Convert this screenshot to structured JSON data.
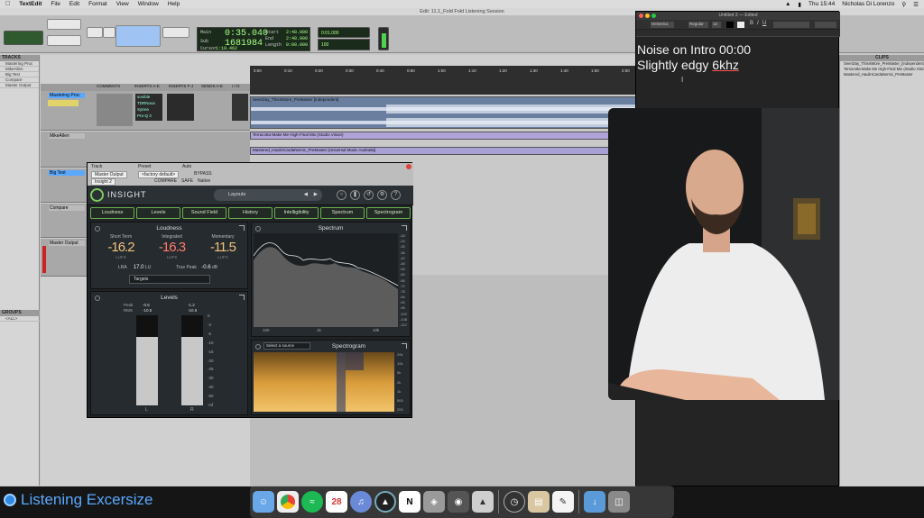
{
  "menubar": {
    "app": "TextEdit",
    "items": [
      "File",
      "Edit",
      "Format",
      "View",
      "Window",
      "Help"
    ],
    "clock": "Thu 15:44",
    "user": "Nicholas Di Lorenzo"
  },
  "protools": {
    "title": "Edit: 11.1_Fold Fold Listening Session",
    "counter": {
      "main_label": "Main",
      "main_value": "0:35.040",
      "sub_label": "Sub",
      "sub_value": "1681984",
      "start_label": "Start",
      "start_value": "2:48.000",
      "end_label": "End",
      "end_value": "2:48.000",
      "length_label": "Length",
      "length_value": "0:00.000",
      "cursor_label": "Cursor",
      "cursor_value": "1:19.462"
    },
    "grid": "0:01.000",
    "nudge": "100",
    "left_header": "TRACKS",
    "groups_header": "GROUPS",
    "groups_item": "<ALL>",
    "tracks": [
      {
        "name": "Mastering Proc"
      },
      {
        "name": "MikeAllen"
      },
      {
        "name": "Big Test"
      },
      {
        "name": "Compare"
      },
      {
        "name": "Master Output"
      }
    ],
    "insert_headers": [
      "COMMENTS",
      "INSERTS A-E",
      "INSERTS F-J",
      "SENDS A-E",
      "I / O"
    ],
    "plugins": [
      "sonible",
      "TDRNova",
      "Sytree",
      "Pro-Q 3"
    ],
    "ruler": [
      "0:00",
      "0:10",
      "0:20",
      "0:30",
      "0:40",
      "0:50",
      "1:00",
      "1:10",
      "1:20",
      "1:30",
      "1:40",
      "1:50",
      "2:00"
    ],
    "clips": [
      "SeenDay_ThisIsMore_PreMaster [Independent]",
      "Terracotta-Make Me High-Final Mix (Studio Vision)",
      "Mastered_HaulinCardaNemic_PreMaster [Universal Music Australia]"
    ]
  },
  "insight": {
    "track_label": "Track",
    "preset_label": "Preset",
    "auto_label": "Auto",
    "output": "Master Output",
    "preset_value": "<factory default>",
    "insight_slot": "Insight 2",
    "compare": "COMPARE",
    "bypass": "BYPASS",
    "safe": "SAFE",
    "native": "Native",
    "title": "INSIGHT",
    "layouts": "Layouts",
    "tabs": [
      "Loudness",
      "Levels",
      "Sound Field",
      "History",
      "Intelligibility",
      "Spectrum",
      "Spectrogram"
    ],
    "loudness": {
      "title": "Loudness",
      "short_term_label": "Short Term",
      "short_term_value": "-16.2",
      "integrated_label": "Integrated",
      "integrated_value": "-16.3",
      "momentary_label": "Momentary",
      "momentary_value": "-11.5",
      "unit": "LUFS",
      "lra_label": "LRA",
      "lra_value": "17.0",
      "lra_unit": "LU",
      "truepeak_label": "True Peak",
      "truepeak_value": "-0.6",
      "truepeak_unit": "dB",
      "targets": "Targets"
    },
    "levels": {
      "title": "Levels",
      "peak_label": "Peak",
      "rms_label": "RMS",
      "left_peak": "-0.6",
      "left_rms": "-10.5",
      "right_peak": "-1.2",
      "right_rms": "-10.6",
      "scale": [
        "0",
        "-3",
        "-6",
        "-10",
        "-15",
        "-20",
        "-25",
        "-30",
        "-40",
        "-50",
        "-inf"
      ],
      "left_label": "L",
      "right_label": "R",
      "left_fill": 0.76,
      "right_fill": 0.76
    },
    "spectrum": {
      "title": "Spectrum",
      "db_scale": [
        "-18",
        "-24",
        "-30",
        "-36",
        "-42",
        "-48",
        "-54",
        "-60",
        "-66",
        "-72",
        "-78",
        "-84",
        "-90",
        "-96",
        "-102",
        "-108",
        "-112"
      ],
      "freq_labels": [
        "100",
        "1k",
        "10k"
      ]
    },
    "spectrogram": {
      "title": "Spectrogram",
      "source": "Select a source",
      "freq_labels": [
        "20k",
        "10k",
        "5k",
        "2k",
        "1k",
        "500",
        "200"
      ]
    }
  },
  "textedit": {
    "title": "Untitled 3 — Edited",
    "font": "Helvetica",
    "style": "Regular",
    "size": "12",
    "line1": "Noise on Intro 00:00",
    "line2_prefix": "Slightly edgy ",
    "line2_flag": "6khz"
  },
  "clips_panel": {
    "header": "CLIPS",
    "items": [
      "SeenDay_ThisIsMore_PreMaster_[Independent]",
      "Terracotta-Make Me High-Final Mix (Studio Vision)",
      "Mastered_HaulinCardaNemic_PreMaster"
    ]
  },
  "lower_third": "Listening Excersize",
  "dock": {
    "calendar_day": "28",
    "icons": [
      "finder-icon",
      "chrome-icon",
      "spotify-icon",
      "calendar-icon",
      "itunes-icon",
      "protools-icon",
      "notion-icon",
      "atlas-icon",
      "camera-icon",
      "preview-icon",
      "clock-icon",
      "folder-icon",
      "textedit-icon",
      "downloads-icon",
      "trash-icon"
    ]
  },
  "colors": {
    "accent_blue": "#5aa9ff",
    "insight_green": "#7ecb5e",
    "loudness_orange": "#f1c27a",
    "loudness_red": "#ff7a6b",
    "counter_green": "#a7ff86"
  }
}
